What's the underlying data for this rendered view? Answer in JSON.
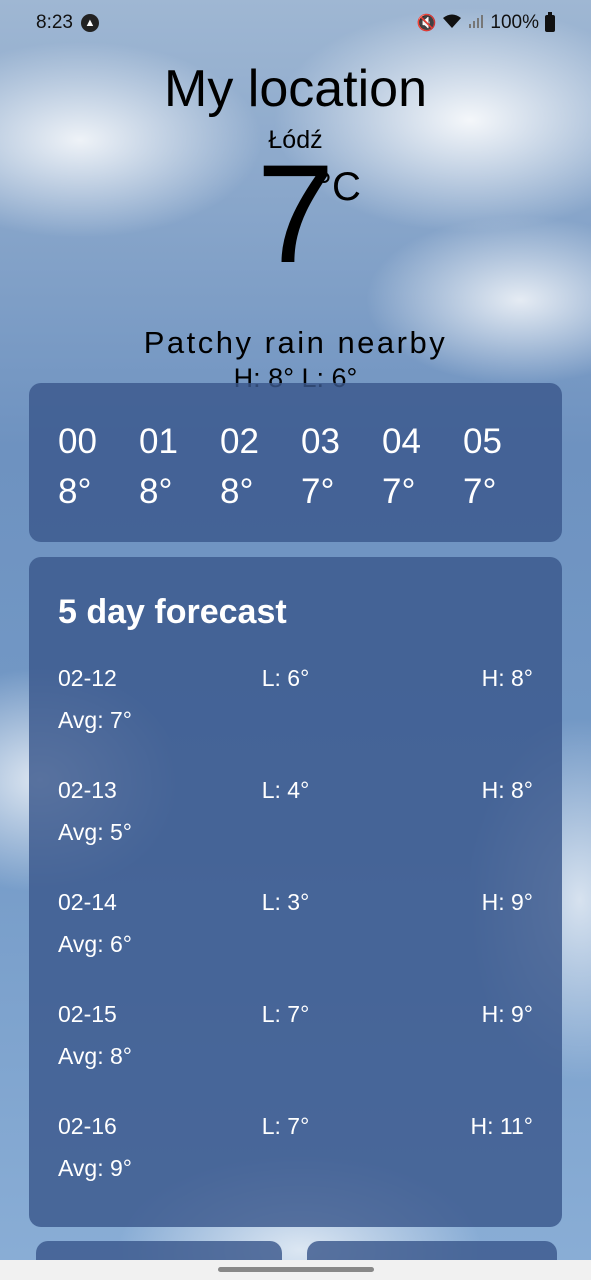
{
  "status": {
    "time": "8:23",
    "battery": "100%",
    "icons": [
      "app-notification-icon",
      "mute-icon",
      "wifi-icon",
      "signal-icon",
      "battery-icon"
    ]
  },
  "header": {
    "title": "My location",
    "city": "Łódź",
    "temperature": "7",
    "unit": "°C",
    "condition": "Patchy rain nearby",
    "hilo": "H: 8° L: 6°"
  },
  "hourly": [
    {
      "time": "00",
      "temp": "8°"
    },
    {
      "time": "01",
      "temp": "8°"
    },
    {
      "time": "02",
      "temp": "8°"
    },
    {
      "time": "03",
      "temp": "7°"
    },
    {
      "time": "04",
      "temp": "7°"
    },
    {
      "time": "05",
      "temp": "7°"
    }
  ],
  "forecast": {
    "title": "5 day forecast",
    "days": [
      {
        "date": "02-12",
        "low": "L: 6°",
        "high": "H: 8°",
        "avg": "Avg: 7°"
      },
      {
        "date": "02-13",
        "low": "L: 4°",
        "high": "H: 8°",
        "avg": "Avg: 5°"
      },
      {
        "date": "02-14",
        "low": "L: 3°",
        "high": "H: 9°",
        "avg": "Avg: 6°"
      },
      {
        "date": "02-15",
        "low": "L: 7°",
        "high": "H: 9°",
        "avg": "Avg: 8°"
      },
      {
        "date": "02-16",
        "low": "L: 7°",
        "high": "H: 11°",
        "avg": "Avg: 9°"
      }
    ]
  },
  "colors": {
    "card": "#3a588c",
    "text_light": "#ffffff",
    "text_dark": "#000000"
  }
}
